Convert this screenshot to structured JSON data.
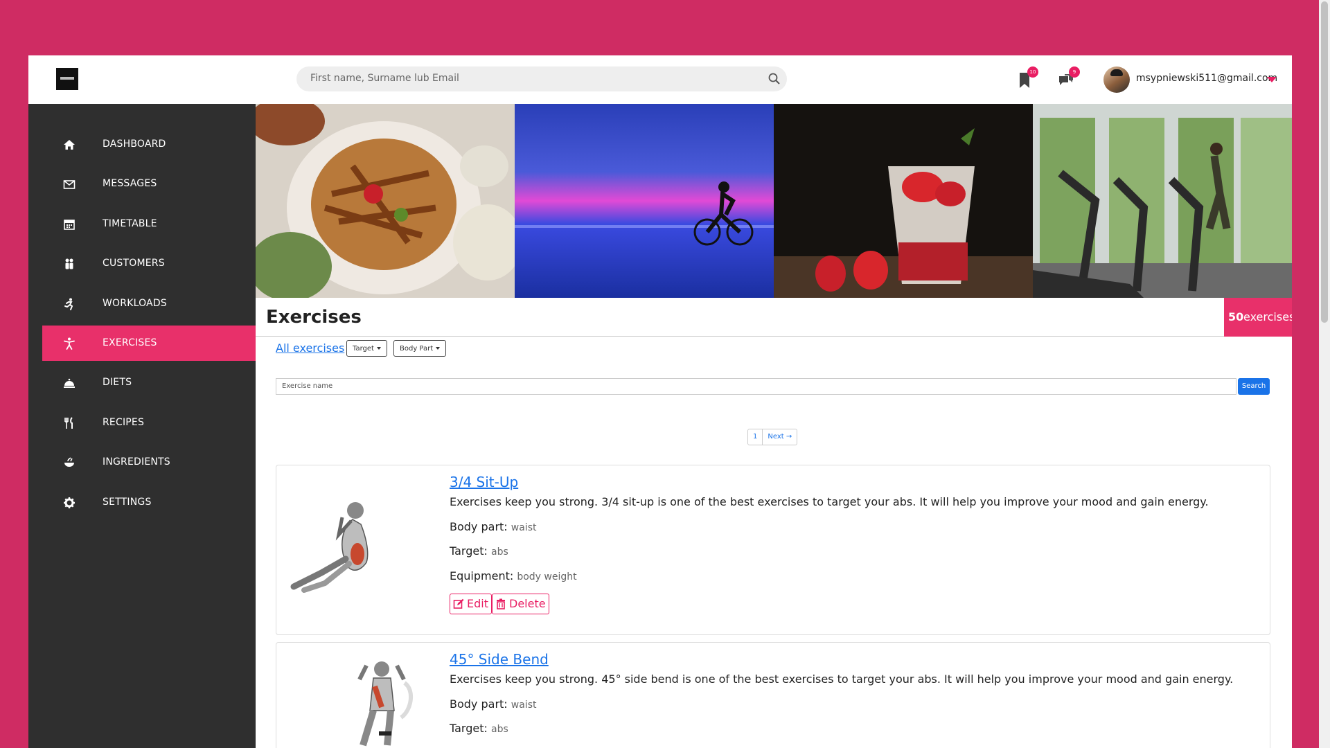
{
  "header": {
    "search_placeholder": "First name, Surname lub Email",
    "bookmarks_count": "10",
    "messages_count": "9",
    "user_email": "msypniewski511@gmail.com"
  },
  "sidebar": {
    "items": [
      {
        "label": "DASHBOARD",
        "icon": "home-icon"
      },
      {
        "label": "MESSAGES",
        "icon": "envelope-icon"
      },
      {
        "label": "TIMETABLE",
        "icon": "calendar-icon"
      },
      {
        "label": "CUSTOMERS",
        "icon": "users-icon"
      },
      {
        "label": "WORKLOADS",
        "icon": "running-icon"
      },
      {
        "label": "EXERCISES",
        "icon": "person-icon",
        "active": true
      },
      {
        "label": "DIETS",
        "icon": "cloche-icon"
      },
      {
        "label": "RECIPES",
        "icon": "utensils-icon"
      },
      {
        "label": "INGREDIENTS",
        "icon": "bowl-icon"
      },
      {
        "label": "SETTINGS",
        "icon": "gear-icon"
      }
    ]
  },
  "colors": {
    "accent": "#e8306a",
    "link": "#1a73e8",
    "sidebar": "#2f2f2f",
    "page_bg": "#cf2c63"
  },
  "main": {
    "title": "Exercises",
    "count_number": "50",
    "count_label": "exercises",
    "all_link": "All exercises",
    "filter_target": "Target",
    "filter_body_part": "Body Part",
    "exercise_name_placeholder": "Exercise name",
    "search_button": "Search",
    "pagination": {
      "page": "1",
      "next": "Next →"
    },
    "labels": {
      "body_part": "Body part:",
      "target": "Target:",
      "equipment": "Equipment:"
    },
    "exercises": [
      {
        "name": "3/4 Sit-Up",
        "description": "Exercises keep you strong. 3/4 sit-up is one of the best exercises to target your abs. It will help you improve your mood and gain energy.",
        "body_part": "waist",
        "target": "abs",
        "equipment": "body weight",
        "edit": "Edit",
        "delete": "Delete"
      },
      {
        "name": "45° Side Bend",
        "description": "Exercises keep you strong. 45° side bend is one of the best exercises to target your abs. It will help you improve your mood and gain energy.",
        "body_part": "waist",
        "target": "abs"
      }
    ]
  }
}
